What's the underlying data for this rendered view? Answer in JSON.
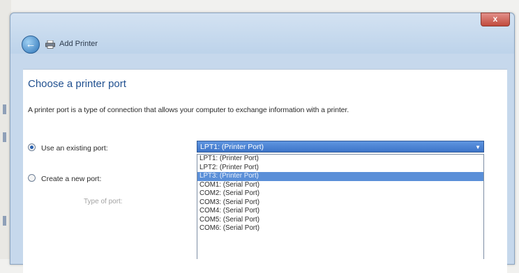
{
  "window": {
    "title": "Add Printer",
    "close_glyph": "x"
  },
  "nav": {
    "back_icon": "back-arrow-icon",
    "printer_icon": "printer-icon"
  },
  "page": {
    "heading": "Choose a printer port",
    "description": "A printer port is a type of connection that allows your computer to exchange information with a printer."
  },
  "options": {
    "existing_port_label": "Use an existing port:",
    "existing_port_checked": true,
    "new_port_label": "Create a new port:",
    "new_port_checked": false,
    "port_type_label": "Type of port:"
  },
  "port_select": {
    "selected_value": "LPT1: (Printer Port)",
    "items": [
      "LPT1: (Printer Port)",
      "LPT2: (Printer Port)",
      "LPT3: (Printer Port)",
      "COM1: (Serial Port)",
      "COM2: (Serial Port)",
      "COM3: (Serial Port)",
      "COM4: (Serial Port)",
      "COM5: (Serial Port)",
      "COM6: (Serial Port)"
    ],
    "highlighted_index": 2
  },
  "colors": {
    "accent": "#3d75c8",
    "title_blue": "#1f4f8f"
  }
}
